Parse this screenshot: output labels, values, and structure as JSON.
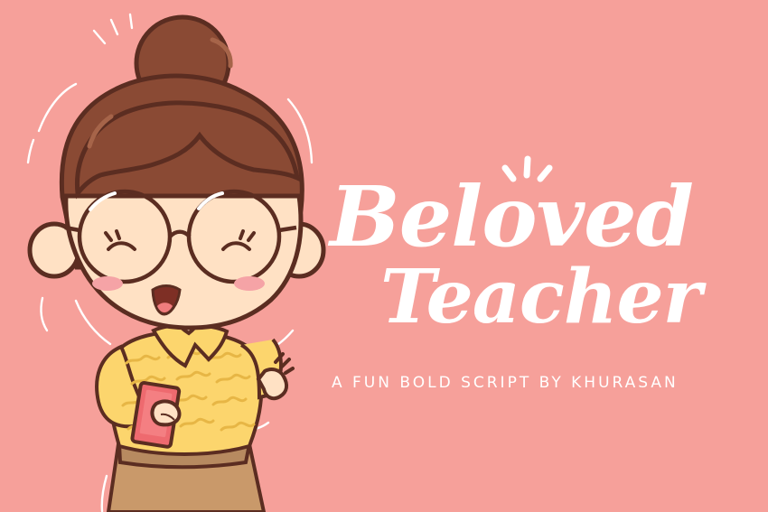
{
  "colors": {
    "background": "#f6a09a",
    "text": "#ffffff",
    "hair": "#8a4a34",
    "skin": "#ffe1c4",
    "blouse": "#fcd56d",
    "skirt": "#c9996a",
    "book": "#ee6a6f",
    "outline": "#5b2d21"
  },
  "title": {
    "line1": "Beloved",
    "line2": "Teacher"
  },
  "tagline": "A FUN BOLD SCRIPT BY KHURASAN",
  "illustration": {
    "subject": "teacher-character",
    "details": [
      "hair-bun",
      "round-glasses",
      "smiling",
      "waving-hand",
      "yellow-wavy-blouse",
      "red-book",
      "brown-skirt"
    ]
  }
}
